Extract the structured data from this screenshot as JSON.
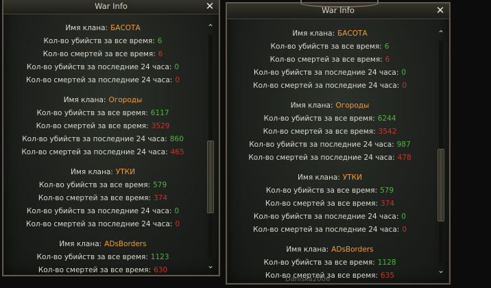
{
  "windows": [
    {
      "title": "War Info",
      "clans": [
        {
          "name_label": "Имя клана:",
          "name": "БАСОТА",
          "stats": [
            {
              "label": "Кол-во убийств за все время:",
              "value": "6",
              "color": "g"
            },
            {
              "label": "Кол-во смертей за все время:",
              "value": "6",
              "color": "r"
            },
            {
              "label": "Кол-во убийств за последние 24 часа:",
              "value": "0",
              "color": "g"
            },
            {
              "label": "Кол-во смертей за последние 24 часа:",
              "value": "0",
              "color": "r"
            }
          ]
        },
        {
          "name_label": "Имя клана:",
          "name": "Огороды",
          "stats": [
            {
              "label": "Кол-во убийств за все время:",
              "value": "6117",
              "color": "g"
            },
            {
              "label": "Кол-во смертей за все время:",
              "value": "3529",
              "color": "r"
            },
            {
              "label": "Кол-во убийств за последние 24 часа:",
              "value": "860",
              "color": "g"
            },
            {
              "label": "Кол-во смертей за последние 24 часа:",
              "value": "465",
              "color": "r"
            }
          ]
        },
        {
          "name_label": "Имя клана:",
          "name": "УТКИ",
          "stats": [
            {
              "label": "Кол-во убийств за все время:",
              "value": "579",
              "color": "g"
            },
            {
              "label": "Кол-во смертей за все время:",
              "value": "374",
              "color": "r"
            },
            {
              "label": "Кол-во убийств за последние 24 часа:",
              "value": "0",
              "color": "g"
            },
            {
              "label": "Кол-во смертей за последние 24 часа:",
              "value": "0",
              "color": "r"
            }
          ]
        },
        {
          "name_label": "Имя клана:",
          "name": "ADsBorders",
          "stats": [
            {
              "label": "Кол-во убийств за все время:",
              "value": "1123",
              "color": "g"
            },
            {
              "label": "Кол-во смертей за все время:",
              "value": "630",
              "color": "r"
            }
          ]
        }
      ]
    },
    {
      "title": "War Info",
      "clans": [
        {
          "name_label": "Имя клана:",
          "name": "БАСОТА",
          "stats": [
            {
              "label": "Кол-во убийств за все время:",
              "value": "6",
              "color": "g"
            },
            {
              "label": "Кол-во смертей за все время:",
              "value": "6",
              "color": "r"
            },
            {
              "label": "Кол-во убийств за последние 24 часа:",
              "value": "0",
              "color": "g"
            },
            {
              "label": "Кол-во смертей за последние 24 часа:",
              "value": "0",
              "color": "r"
            }
          ]
        },
        {
          "name_label": "Имя клана:",
          "name": "Огороды",
          "stats": [
            {
              "label": "Кол-во убийств за все время:",
              "value": "6244",
              "color": "g"
            },
            {
              "label": "Кол-во смертей за все время:",
              "value": "3542",
              "color": "r"
            },
            {
              "label": "Кол-во убийств за последние 24 часа:",
              "value": "987",
              "color": "g"
            },
            {
              "label": "Кол-во смертей за последние 24 часа:",
              "value": "478",
              "color": "r"
            }
          ]
        },
        {
          "name_label": "Имя клана:",
          "name": "УТКИ",
          "stats": [
            {
              "label": "Кол-во убийств за все время:",
              "value": "579",
              "color": "g"
            },
            {
              "label": "Кол-во смертей за все время:",
              "value": "374",
              "color": "r"
            },
            {
              "label": "Кол-во убийств за последние 24 часа:",
              "value": "0",
              "color": "g"
            },
            {
              "label": "Кол-во смертей за последние 24 часа:",
              "value": "0",
              "color": "r"
            }
          ]
        },
        {
          "name_label": "Имя клана:",
          "name": "ADsBorders",
          "stats": [
            {
              "label": "Кол-во убийств за все время:",
              "value": "1128",
              "color": "g"
            },
            {
              "label": "Кол-во смертей за все время:",
              "value": "635",
              "color": "r"
            }
          ]
        }
      ]
    }
  ],
  "icons": {
    "close": "close-icon",
    "scroll_up": "chevron-up-icon",
    "scroll_down": "chevron-down-icon"
  },
  "footer": {
    "player_name": "Daniska2006"
  },
  "colors": {
    "clan_name": "#f39b2e",
    "kills": "#4cb83a",
    "deaths": "#cc3328",
    "label": "#dcdad0"
  }
}
